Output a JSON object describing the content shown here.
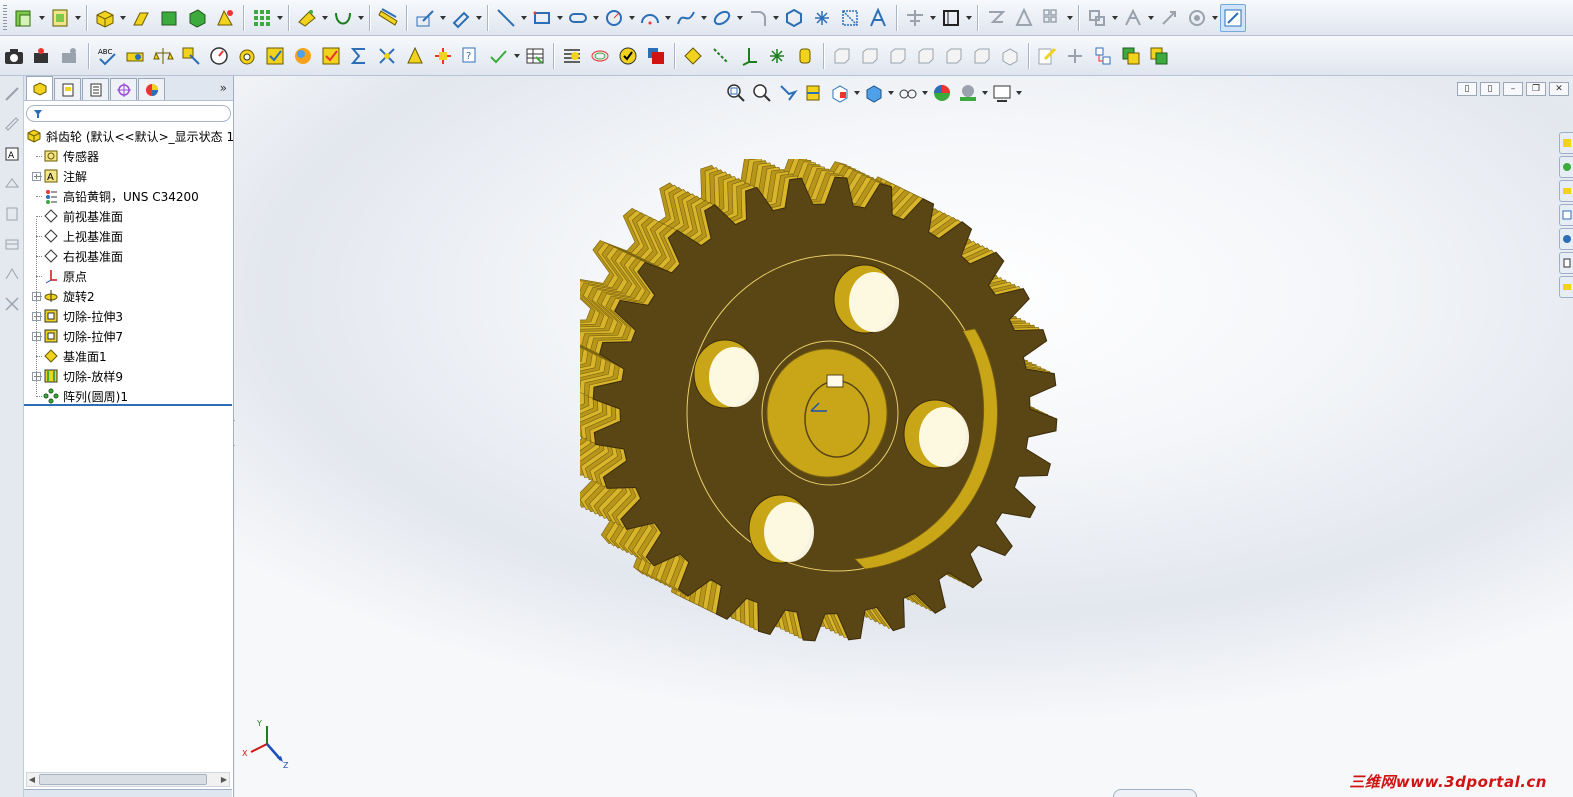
{
  "toolbar_top": {
    "items": [
      "extruded-boss-icon",
      "sketch-boss-icon",
      "loft-icon",
      "revolve-icon",
      "boss-icon",
      "shell-icon",
      "fillet-icon",
      "pattern-icon",
      "reference-geometry-icon",
      "curves-icon",
      "measure-icon",
      "sketch-icon",
      "smart-dimension-icon",
      "line-icon",
      "rectangle-icon",
      "slot-icon",
      "circle-icon",
      "arc-icon",
      "spline-icon",
      "ellipse-icon",
      "fillet-sketch-icon",
      "polygon-icon",
      "point-icon",
      "convert-entities-icon",
      "text-icon",
      "trim-icon",
      "offset-icon",
      "mirror-icon",
      "linear-pattern-icon",
      "move-entities-icon",
      "display-relations-icon",
      "repair-sketch-icon",
      "quick-snaps-icon",
      "instant3d-icon"
    ]
  },
  "toolbar_second": {
    "items": [
      "photo-icon",
      "render-icon",
      "spell-check-icon",
      "hole-wizard-icon",
      "balance-icon",
      "mate-icon",
      "gauge-icon",
      "simulation-icon",
      "check-icon",
      "appearance-icon",
      "check-icon-2",
      "sum-icon",
      "deviation-icon",
      "draft-icon",
      "thickness-icon",
      "compare-icon",
      "analysis-icon",
      "table-icon",
      "zebra-icon",
      "curvature-icon",
      "check-entity-icon",
      "red-square-icon",
      "plane-icon",
      "axis-icon",
      "coordinate-icon",
      "point-ref-icon",
      "mate-ref-icon",
      "view-front-icon",
      "view-back-icon",
      "view-left-icon",
      "view-right-icon",
      "view-top-icon",
      "view-bottom-icon",
      "view-iso-icon",
      "annotation-icon",
      "add-relation-icon",
      "flag-icon",
      "layer-icon",
      "layer-icon-2"
    ]
  },
  "feature_tree": {
    "root_label": "斜齿轮 (默认<<默认>_显示状态 1",
    "items": [
      {
        "label": "传感器",
        "icon": "sensor-icon",
        "expandable": false
      },
      {
        "label": "注解",
        "icon": "annotations-icon",
        "expandable": true
      },
      {
        "label": "高铅黄铜，UNS C34200",
        "icon": "material-icon",
        "expandable": false
      },
      {
        "label": "前视基准面",
        "icon": "plane-icon",
        "expandable": false
      },
      {
        "label": "上视基准面",
        "icon": "plane-icon",
        "expandable": false
      },
      {
        "label": "右视基准面",
        "icon": "plane-icon",
        "expandable": false
      },
      {
        "label": "原点",
        "icon": "origin-icon",
        "expandable": false
      },
      {
        "label": "旋转2",
        "icon": "revolve-feature-icon",
        "expandable": true
      },
      {
        "label": "切除-拉伸3",
        "icon": "cut-extrude-icon",
        "expandable": true
      },
      {
        "label": "切除-拉伸7",
        "icon": "cut-extrude-icon",
        "expandable": true
      },
      {
        "label": "基准面1",
        "icon": "plane-feature-icon",
        "expandable": false
      },
      {
        "label": "切除-放样9",
        "icon": "cut-loft-icon",
        "expandable": true
      },
      {
        "label": "阵列(圆周)1",
        "icon": "circular-pattern-icon",
        "expandable": false
      }
    ]
  },
  "panel_tabs": [
    "feature-manager-tab",
    "property-manager-tab",
    "configuration-manager-tab",
    "dimxpert-tab",
    "display-manager-tab"
  ],
  "graphics": {
    "triad": {
      "x": "X",
      "y": "Y",
      "z": "Z"
    },
    "watermark": "三维网www.3dportal.cn",
    "gear_color": "#c9a618",
    "gear_face_color": "#5a4514"
  },
  "window_buttons": [
    "tile-h",
    "tile-v",
    "minimize",
    "restore",
    "close"
  ],
  "colors": {
    "toolbar_bg": "#e8edf4",
    "accent": "#2c6fb6",
    "watermark": "#d01414"
  }
}
